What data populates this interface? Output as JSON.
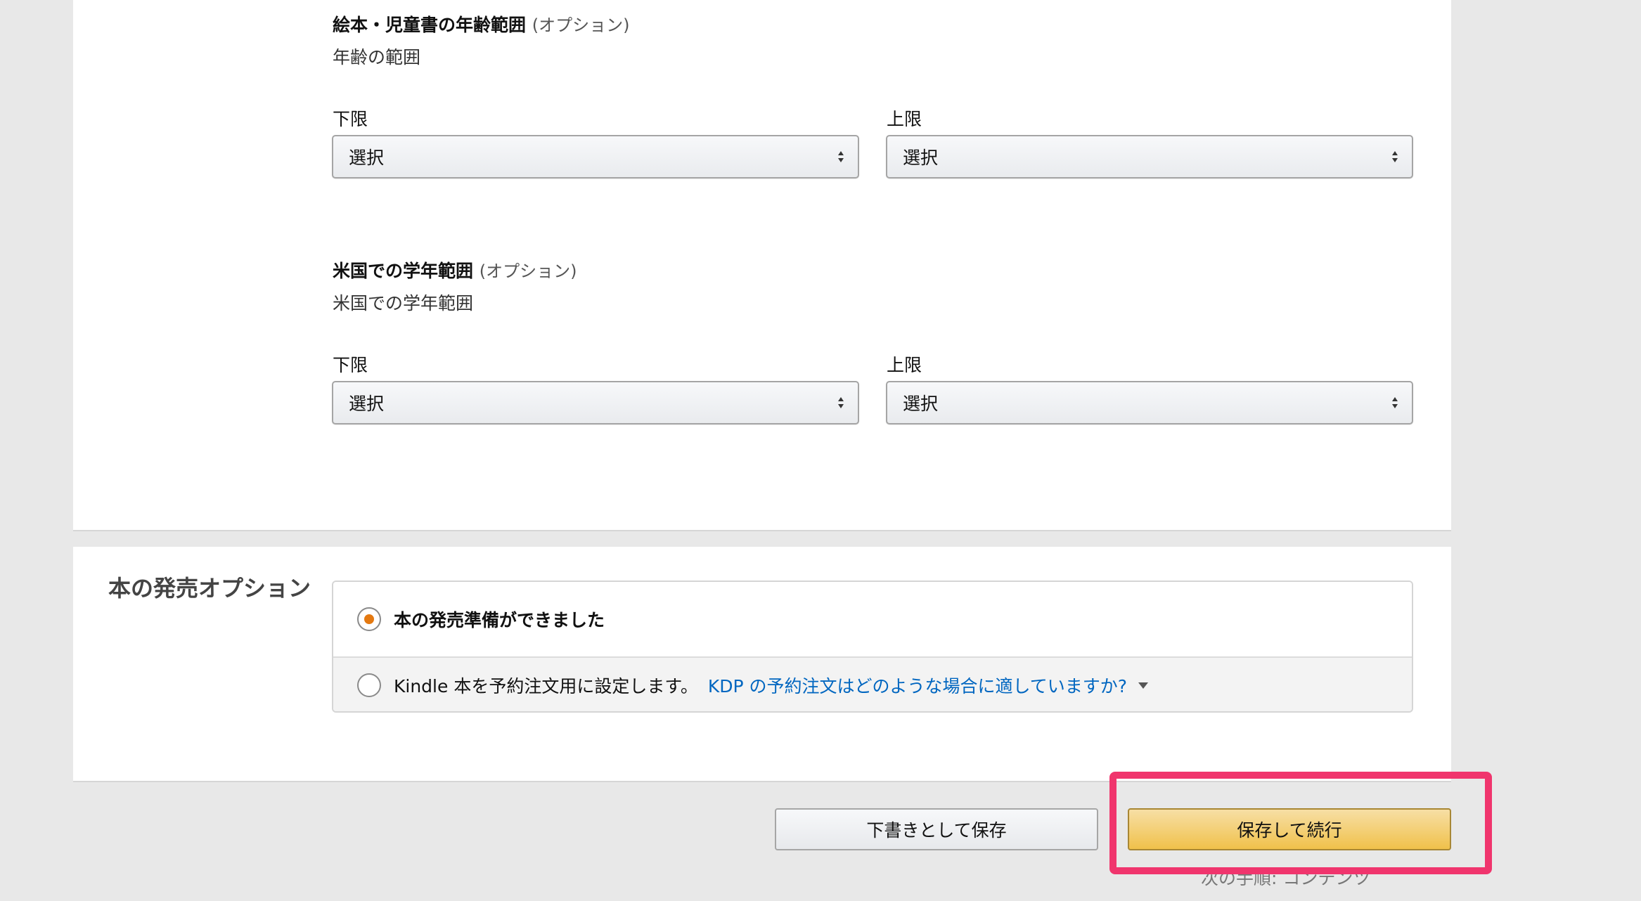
{
  "age_range": {
    "title": "絵本・児童書の年齢範囲",
    "optional": "(オプション)",
    "subtitle": "年齢の範囲",
    "lower_label": "下限",
    "upper_label": "上限",
    "lower_value": "選択",
    "upper_value": "選択"
  },
  "grade_range": {
    "title": "米国での学年範囲",
    "optional": "(オプション)",
    "subtitle": "米国での学年範囲",
    "lower_label": "下限",
    "upper_label": "上限",
    "lower_value": "選択",
    "upper_value": "選択"
  },
  "release": {
    "title": "本の発売オプション",
    "option_ready": "本の発売準備ができました",
    "option_preorder": "Kindle 本を予約注文用に設定します。",
    "preorder_help_link": "KDP の予約注文はどのような場合に適していますか?",
    "selected": "option_ready"
  },
  "actions": {
    "save_draft": "下書きとして保存",
    "save_continue": "保存して続行",
    "next_step": "次の手順: コンテンツ"
  },
  "colors": {
    "highlight": "#f0356d",
    "primary_button": "#f0c14b",
    "link": "#0066c0",
    "radio_selected": "#e47911"
  }
}
